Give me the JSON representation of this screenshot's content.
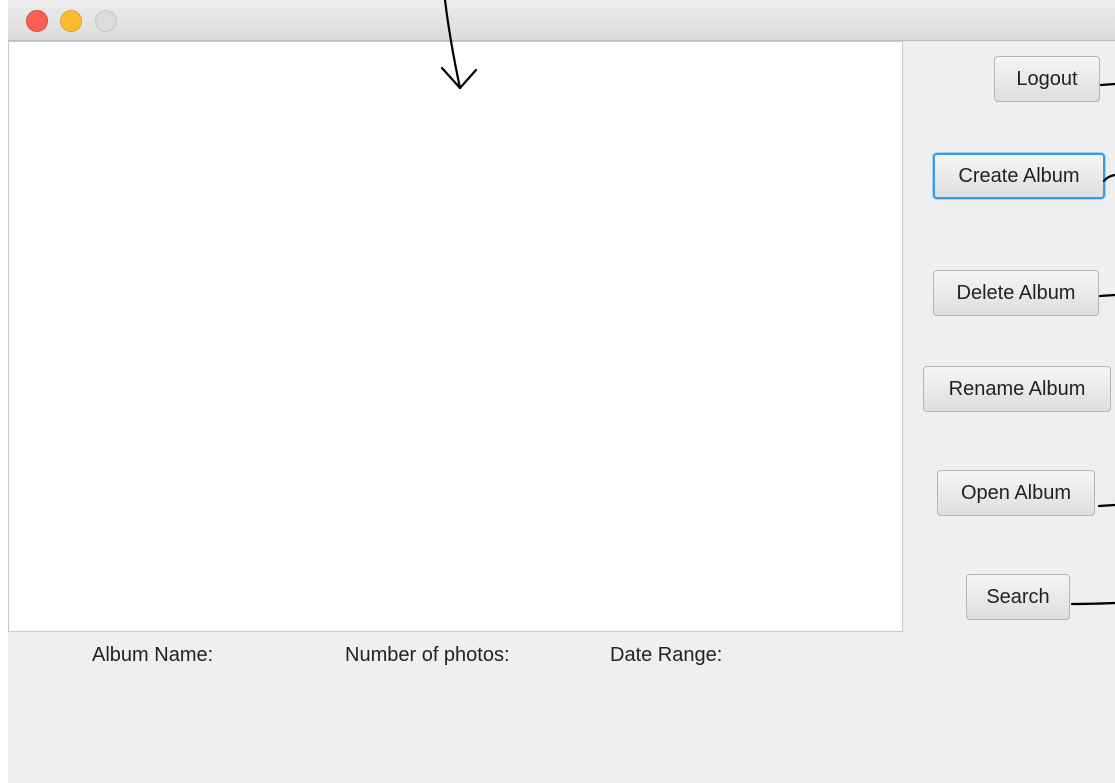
{
  "window": {
    "traffic_lights": [
      "close",
      "minimize",
      "zoom"
    ]
  },
  "buttons": {
    "logout": "Logout",
    "create_album": "Create Album",
    "delete_album": "Delete Album",
    "rename_album": "Rename Album",
    "open_album": "Open Album",
    "search": "Search"
  },
  "details": {
    "album_name_label": "Album Name:",
    "photo_count_label": "Number of photos:",
    "date_range_label": "Date Range:"
  },
  "colors": {
    "close": "#fc5f57",
    "minimize": "#fdbc2e",
    "zoom_disabled": "#dcdcdc",
    "focus_ring": "#3b9be0",
    "window_background": "#efefef"
  }
}
